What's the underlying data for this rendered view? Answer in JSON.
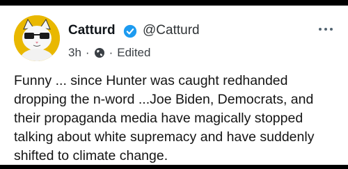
{
  "post": {
    "display_name": "Catturd",
    "handle": "@Catturd",
    "time": "3h",
    "separator": "·",
    "edited_label": "Edited",
    "more_icon": "more-dots-icon",
    "verified_icon": "verified-badge-icon",
    "visibility_icon": "globe-icon",
    "text": "Funny ... since Hunter was caught redhanded dropping the n-word ...Joe Biden, Democrats, and their propaganda media have magically stopped talking about white supremacy and have suddenly shifted to climate change."
  },
  "colors": {
    "background": "#000000",
    "card": "#ffffff",
    "avatar_bg": "#e9b800",
    "verified": "#1d9bf0"
  }
}
